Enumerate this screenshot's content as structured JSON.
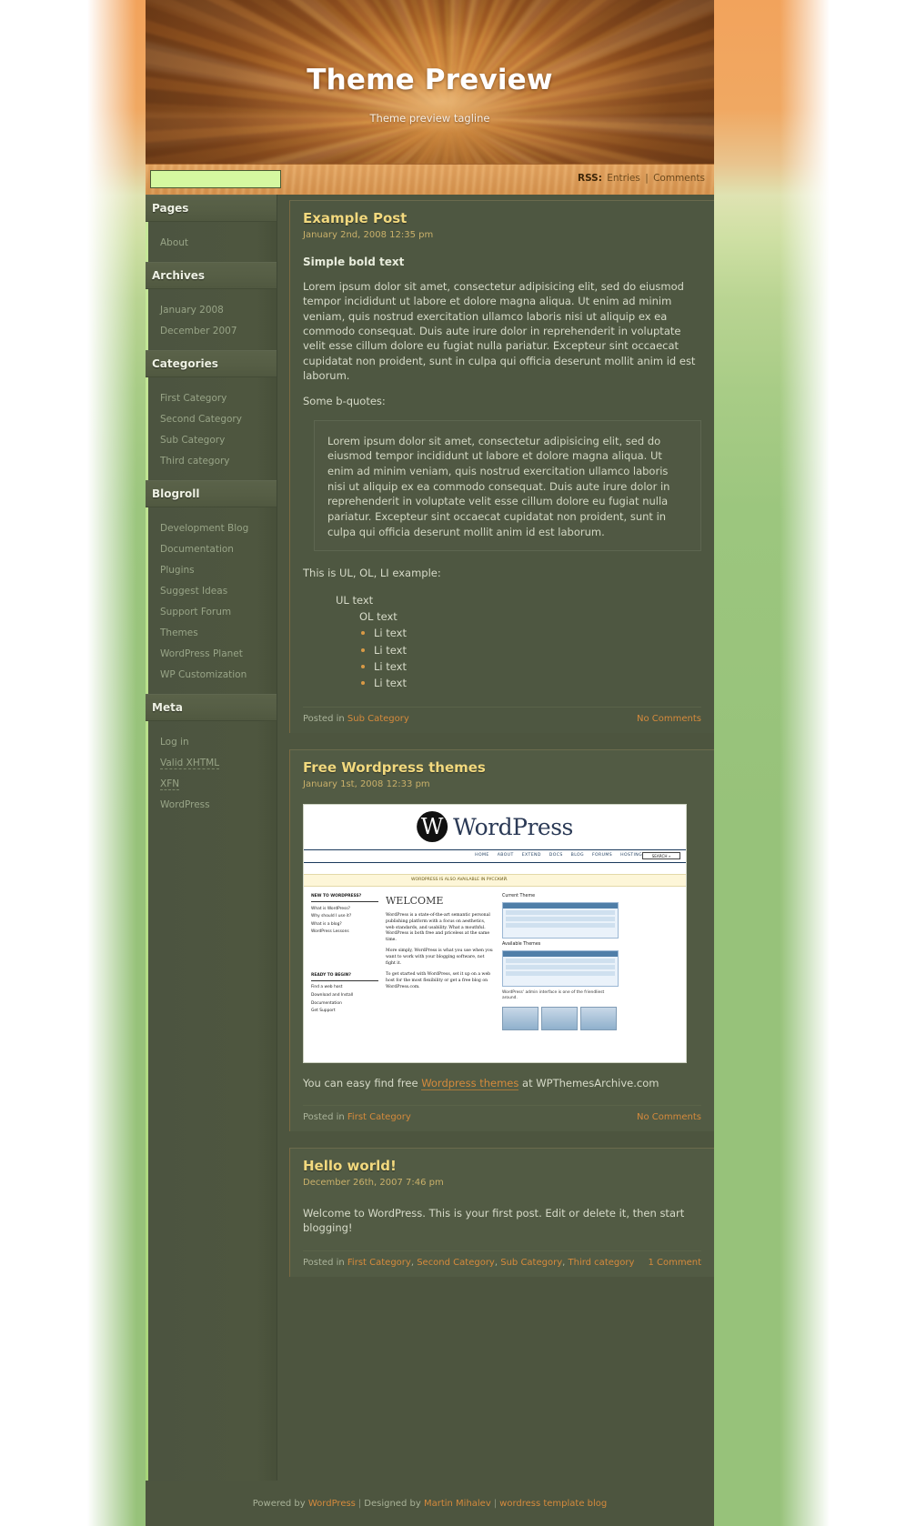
{
  "site": {
    "title": "Theme Preview",
    "tagline": "Theme preview tagline"
  },
  "search": {
    "value": "",
    "placeholder": ""
  },
  "rss": {
    "label": "RSS:",
    "entries": "Entries",
    "separator": "|",
    "comments": "Comments"
  },
  "sidebar": {
    "widgets": [
      {
        "title": "Pages",
        "items": [
          "About"
        ]
      },
      {
        "title": "Archives",
        "items": [
          "January 2008",
          "December 2007"
        ]
      },
      {
        "title": "Categories",
        "items": [
          "First Category",
          "Second Category",
          "Sub Category",
          "Third category"
        ]
      },
      {
        "title": "Blogroll",
        "items": [
          "Development Blog",
          "Documentation",
          "Plugins",
          "Suggest Ideas",
          "Support Forum",
          "Themes",
          "WordPress Planet",
          "WP Customization"
        ]
      },
      {
        "title": "Meta",
        "items": [
          "Log in",
          "Valid XHTML",
          "XFN",
          "WordPress"
        ]
      }
    ]
  },
  "posts": [
    {
      "title": "Example Post",
      "date": "January 2nd, 2008 12:35 pm",
      "heading": "Simple bold text",
      "paragraph": "Lorem ipsum dolor sit amet, consectetur adipisicing elit, sed do eiusmod tempor incididunt ut labore et dolore magna aliqua. Ut enim ad minim veniam, quis nostrud exercitation ullamco laboris nisi ut aliquip ex ea commodo consequat. Duis aute irure dolor in reprehenderit in voluptate velit esse cillum dolore eu fugiat nulla pariatur. Excepteur sint occaecat cupidatat non proident, sunt in culpa qui officia deserunt mollit anim id est laborum.",
      "quote_intro": "Some b-quotes:",
      "blockquote": "Lorem ipsum dolor sit amet, consectetur adipisicing elit, sed do eiusmod tempor incididunt ut labore et dolore magna aliqua. Ut enim ad minim veniam, quis nostrud exercitation ullamco laboris nisi ut aliquip ex ea commodo consequat. Duis aute irure dolor in reprehenderit in voluptate velit esse cillum dolore eu fugiat nulla pariatur. Excepteur sint occaecat cupidatat non proident, sunt in culpa qui officia deserunt mollit anim id est laborum.",
      "list_intro": "This is UL, OL, LI example:",
      "ul_text": "UL text",
      "ol_text": "OL text",
      "li_items": [
        "Li text",
        "Li text",
        "Li text",
        "Li text"
      ],
      "posted_in_label": "Posted in",
      "categories": [
        "Sub Category"
      ],
      "comments": "No Comments"
    },
    {
      "title": "Free Wordpress themes",
      "date": "January 1st, 2008 12:33 pm",
      "caption_before": "You can easy find free",
      "caption_link": "Wordpress themes",
      "caption_after": "at WPThemesArchive.com",
      "posted_in_label": "Posted in",
      "categories": [
        "First Category"
      ],
      "comments": "No Comments",
      "screenshot": {
        "brand": "WordPress",
        "brand_mark": "W",
        "nav": [
          "HOME",
          "ABOUT",
          "EXTEND",
          "DOCS",
          "BLOG",
          "FORUMS",
          "HOSTING",
          "DOWNLOAD"
        ],
        "search_button": "SEARCH »",
        "notice": "WORDPRESS IS ALSO AVAILABLE IN РУССКИЙ.",
        "col1_heading": "NEW TO WORDPRESS?",
        "col1_items": [
          "What is WordPress?",
          "Why should I use it?",
          "What is a blog?",
          "WordPress Lessons"
        ],
        "col1_heading2": "READY TO BEGIN?",
        "col1_items2": [
          "Find a web host",
          "Download and Install",
          "Documentation",
          "Get Support"
        ],
        "welcome": "WELCOME",
        "p1": "WordPress is a state-of-the-art semantic personal publishing platform with a focus on aesthetics, web standards, and usability. What a mouthful. WordPress is both free and priceless at the same time.",
        "p2": "More simply, WordPress is what you use when you want to work with your blogging software, not fight it.",
        "p3": "To get started with WordPress, set it up on a web host for the most flexibility or get a free blog on WordPress.com.",
        "col3_heading": "Current Theme",
        "col3_heading2": "Available Themes",
        "col3_caption": "WordPress' admin interface is one of the friendliest around."
      }
    },
    {
      "title": "Hello world!",
      "date": "December 26th, 2007 7:46 pm",
      "paragraph": "Welcome to WordPress. This is your first post. Edit or delete it, then start blogging!",
      "posted_in_label": "Posted in",
      "categories": [
        "First Category",
        "Second Category",
        "Sub Category",
        "Third category"
      ],
      "comments": "1 Comment"
    }
  ],
  "footer": {
    "powered_by": "Powered by",
    "wordpress": "WordPress",
    "sep1": "|",
    "designed_by": "Designed by",
    "designer": "Martin Mihalev",
    "sep2": "|",
    "template_blog": "wordress template blog"
  },
  "colors": {
    "accent_gold": "#f2d97e",
    "accent_orange": "#d58a3c",
    "sidebar_bg": "#4c5440",
    "content_bg": "#4e5741",
    "search_bg": "#d5f8a0"
  }
}
